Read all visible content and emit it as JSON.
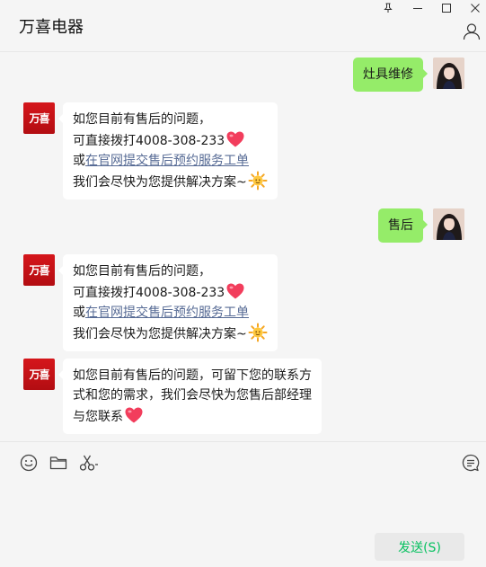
{
  "header": {
    "title": "万喜电器",
    "pin_icon": "pin-icon",
    "minimize_icon": "minimize-icon",
    "maximize_icon": "maximize-icon",
    "close_icon": "close-icon",
    "profile_icon": "person-icon"
  },
  "brand_avatar_text": "万喜",
  "messages": [
    {
      "from": "me",
      "text": "灶具维修"
    },
    {
      "from": "them",
      "lines": [
        "如您目前有售后的问题，",
        "可直接拨打4008-308-233",
        "或",
        "在官网提交售后预约服务工单",
        "我们会尽快为您提供解决方案~"
      ]
    },
    {
      "from": "me",
      "text": "售后"
    },
    {
      "from": "them",
      "lines": [
        "如您目前有售后的问题，",
        "可直接拨打4008-308-233",
        "或",
        "在官网提交售后预约服务工单",
        "我们会尽快为您提供解决方案~"
      ]
    },
    {
      "from": "them",
      "lines": [
        "如您目前有售后的问题，可留下您的联系方",
        "式和您的需求，我们会尽快为您售后部经理",
        "与您联系"
      ]
    }
  ],
  "toolbar": {
    "emoji_icon": "smiley-icon",
    "folder_icon": "folder-icon",
    "screenshot_icon": "scissors-icon",
    "history_icon": "chat-history-icon",
    "send_label": "发送(S)"
  },
  "colors": {
    "outgoing_bubble": "#95ec69",
    "incoming_bubble": "#ffffff",
    "link": "#576b95",
    "send_text": "#07c160",
    "brand_red": "#d5161b"
  }
}
